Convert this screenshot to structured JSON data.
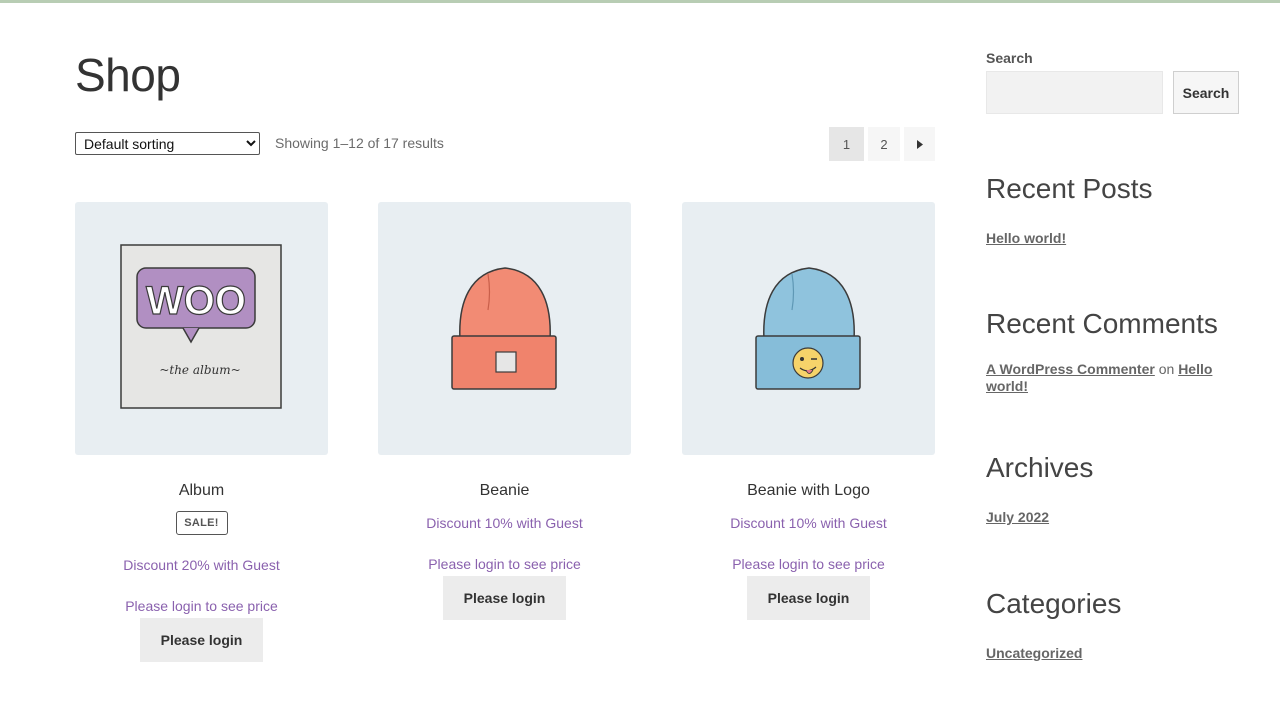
{
  "page": {
    "title": "Shop"
  },
  "toolbar": {
    "sorting_selected": "Default sorting",
    "result_count": "Showing 1–12 of 17 results",
    "pagination": {
      "current": "1",
      "next_page": "2",
      "next_icon": "triangle-right-icon"
    }
  },
  "products": [
    {
      "name": "Album",
      "sale_badge": "SALE!",
      "discount": "Discount 20% with Guest",
      "login_text": "Please login to see price",
      "button": "Please login",
      "image": "woo-album-cover"
    },
    {
      "name": "Beanie",
      "discount": "Discount 10% with Guest",
      "login_text": "Please login to see price",
      "button": "Please login",
      "image": "orange-beanie"
    },
    {
      "name": "Beanie with Logo",
      "discount": "Discount 10% with Guest",
      "login_text": "Please login to see price",
      "button": "Please login",
      "image": "blue-beanie-with-logo"
    }
  ],
  "sidebar": {
    "search": {
      "label": "Search",
      "placeholder": "",
      "button": "Search"
    },
    "recent_posts": {
      "title": "Recent Posts",
      "items": [
        "Hello world!"
      ]
    },
    "recent_comments": {
      "title": "Recent Comments",
      "author": "A WordPress Commenter",
      "connector": "on",
      "post": "Hello world!"
    },
    "archives": {
      "title": "Archives",
      "items": [
        "July 2022"
      ]
    },
    "categories": {
      "title": "Categories",
      "items": [
        "Uncategorized"
      ]
    }
  },
  "colors": {
    "accent_purple": "#8a61ae",
    "thumb_bg": "#e8eef2",
    "button_bg": "#ececec"
  }
}
